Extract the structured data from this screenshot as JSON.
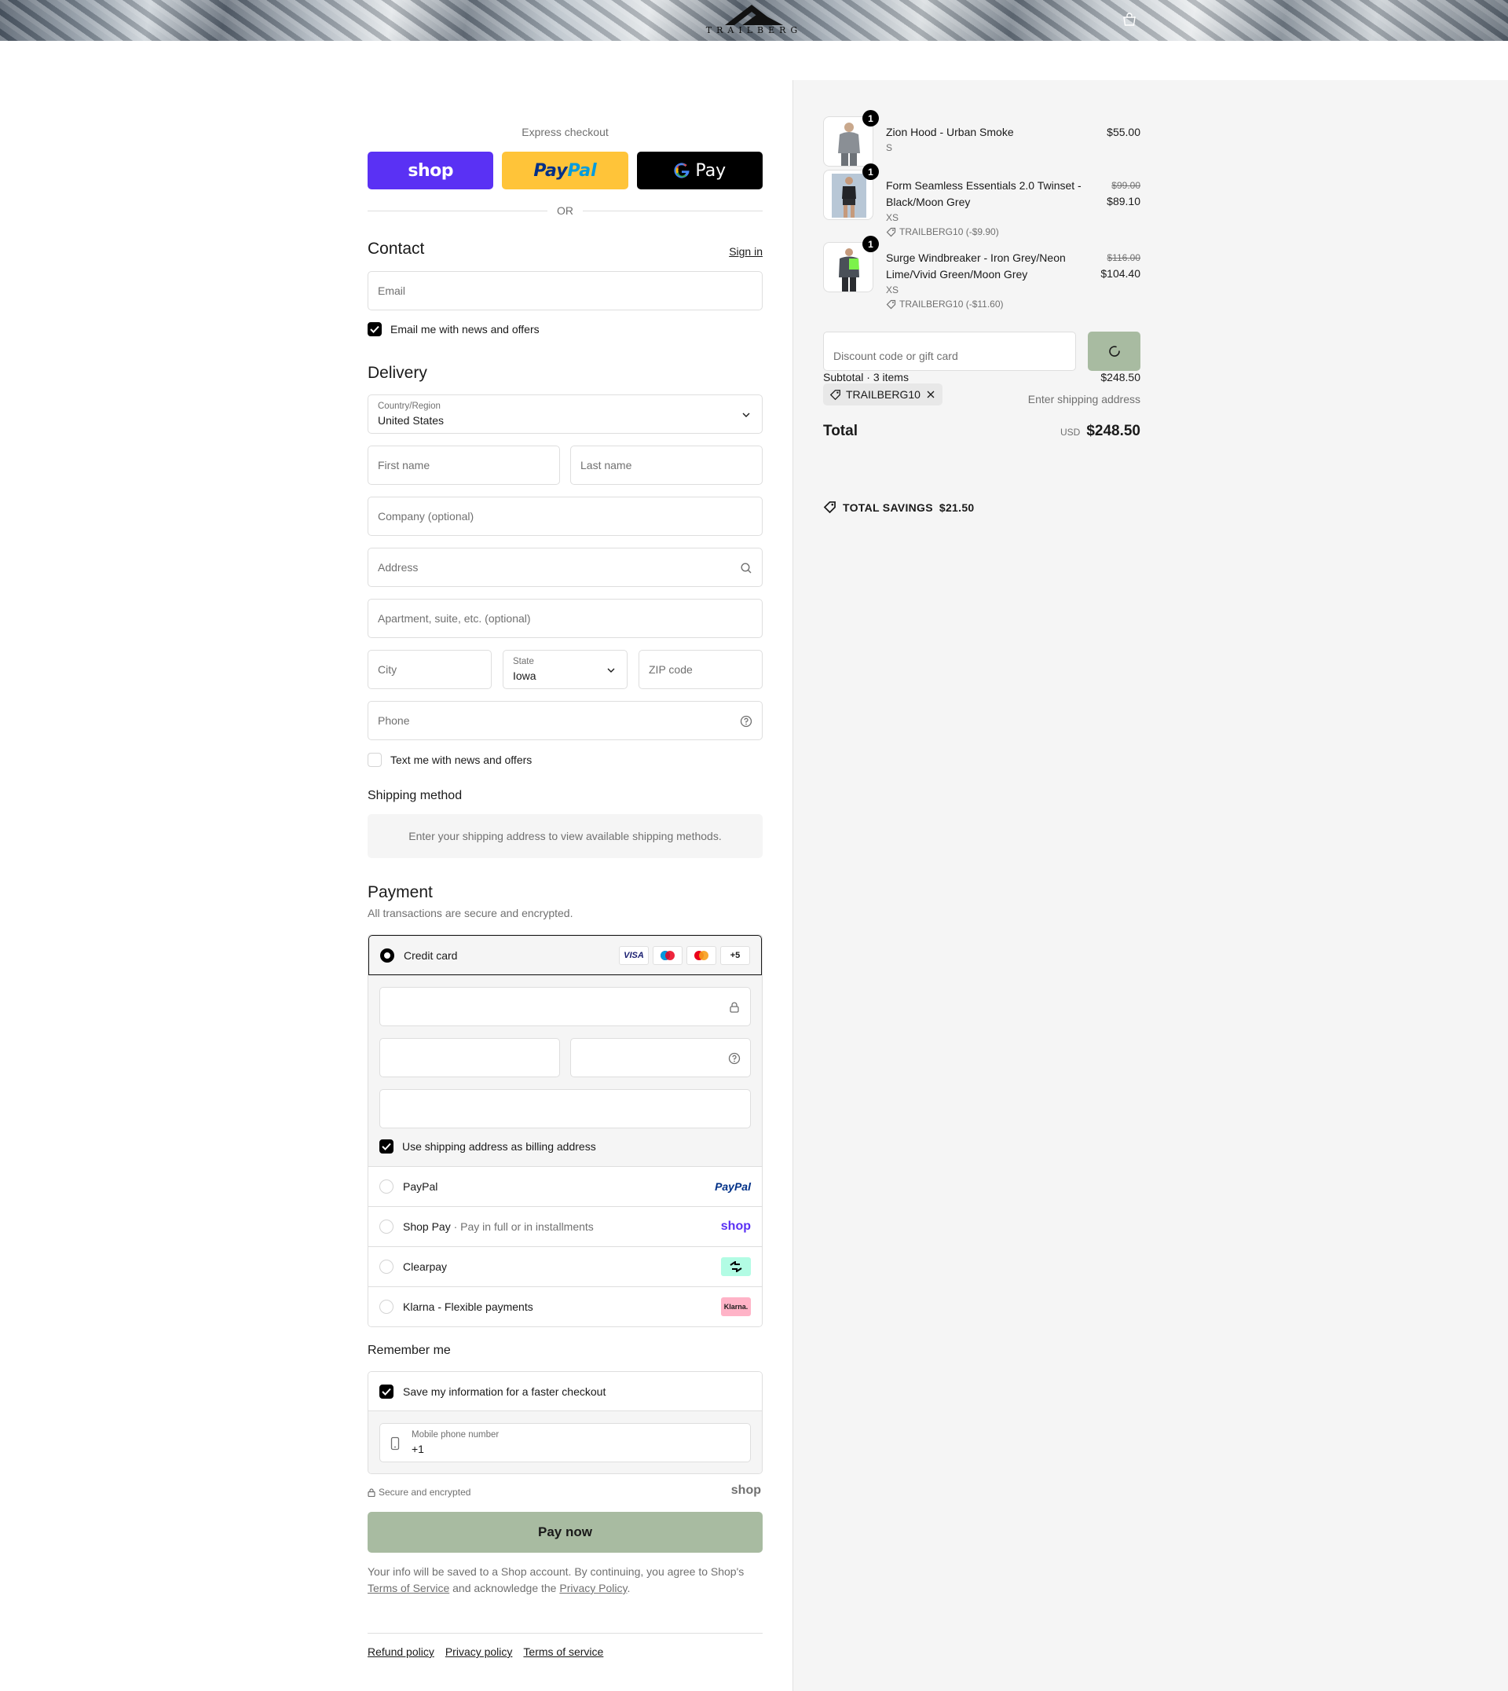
{
  "header": {
    "brand": "TRAILBERG"
  },
  "express": {
    "label": "Express checkout",
    "shop": "shop",
    "paypal_a": "Pay",
    "paypal_b": "Pal",
    "gpay": "Pay",
    "or": "OR"
  },
  "contact": {
    "title": "Contact",
    "sign_in": "Sign in",
    "email_placeholder": "Email",
    "news_checkbox": "Email me with news and offers"
  },
  "delivery": {
    "title": "Delivery",
    "country_label": "Country/Region",
    "country_value": "United States",
    "first_name": "First name",
    "last_name": "Last name",
    "company": "Company (optional)",
    "address": "Address",
    "apartment": "Apartment, suite, etc. (optional)",
    "city": "City",
    "state_label": "State",
    "state_value": "Iowa",
    "zip": "ZIP code",
    "phone": "Phone",
    "sms_checkbox": "Text me with news and offers"
  },
  "shipping": {
    "title": "Shipping method",
    "info": "Enter your shipping address to view available shipping methods."
  },
  "payment": {
    "title": "Payment",
    "subtitle": "All transactions are secure and encrypted.",
    "credit_card": "Credit card",
    "card_logos": [
      "VISA",
      "maestro",
      "mastercard",
      "+5"
    ],
    "billing_checkbox": "Use shipping address as billing address",
    "options": [
      {
        "label": "PayPal",
        "extra": "",
        "badge": "PayPal"
      },
      {
        "label": "Shop Pay",
        "extra": "Pay in full or in installments",
        "badge": "shop"
      },
      {
        "label": "Clearpay",
        "extra": "",
        "badge": "clearpay"
      },
      {
        "label": "Klarna - Flexible payments",
        "extra": "",
        "badge": "Klarna."
      }
    ]
  },
  "remember": {
    "title": "Remember me",
    "save_checkbox": "Save my information for a faster checkout",
    "mobile_label": "Mobile phone number",
    "mobile_value": "+1",
    "secure_text": "Secure and encrypted",
    "shop_badge": "shop"
  },
  "pay_now": "Pay now",
  "legal": {
    "text_1": "Your info will be saved to a Shop account. By continuing, you agree to Shop's",
    "terms_link": "Terms of Service",
    "text_2": "and acknowledge the",
    "privacy_link": "Privacy Policy",
    "text_3": "."
  },
  "footer": {
    "links": [
      "Refund policy",
      "Privacy policy",
      "Terms of service"
    ]
  },
  "summary": {
    "items": [
      {
        "qty": "1",
        "name": "Zion Hood - Urban Smoke",
        "variant": "S",
        "discount": "",
        "old_price": "",
        "price": "$55.00",
        "image_color": "#8a8f95"
      },
      {
        "qty": "1",
        "name": "Form Seamless Essentials 2.0 Twinset - Black/Moon Grey",
        "variant": "XS",
        "discount": "TRAILBERG10 (-$9.90)",
        "old_price": "$99.00",
        "price": "$89.10",
        "image_color": "#222428"
      },
      {
        "qty": "1",
        "name": "Surge Windbreaker - Iron Grey/Neon Lime/Vivid Green/Moon Grey",
        "variant": "XS",
        "discount": "TRAILBERG10 (-$11.60)",
        "old_price": "$116.00",
        "price": "$104.40",
        "image_color": "#4a5058"
      }
    ],
    "discount_placeholder": "Discount code or gift card",
    "subtotal_label": "Subtotal · 3 items",
    "subtotal_value": "$248.50",
    "code_chip": "TRAILBERG10",
    "shipping_value": "Enter shipping address",
    "total_label": "Total",
    "currency": "USD",
    "total_value": "$248.50",
    "savings_label": "TOTAL SAVINGS",
    "savings_value": "$21.50"
  },
  "colors": {
    "accent_button": "#a8bba1",
    "shop_purple": "#5a31f4",
    "paypal_yellow": "#ffc439"
  }
}
